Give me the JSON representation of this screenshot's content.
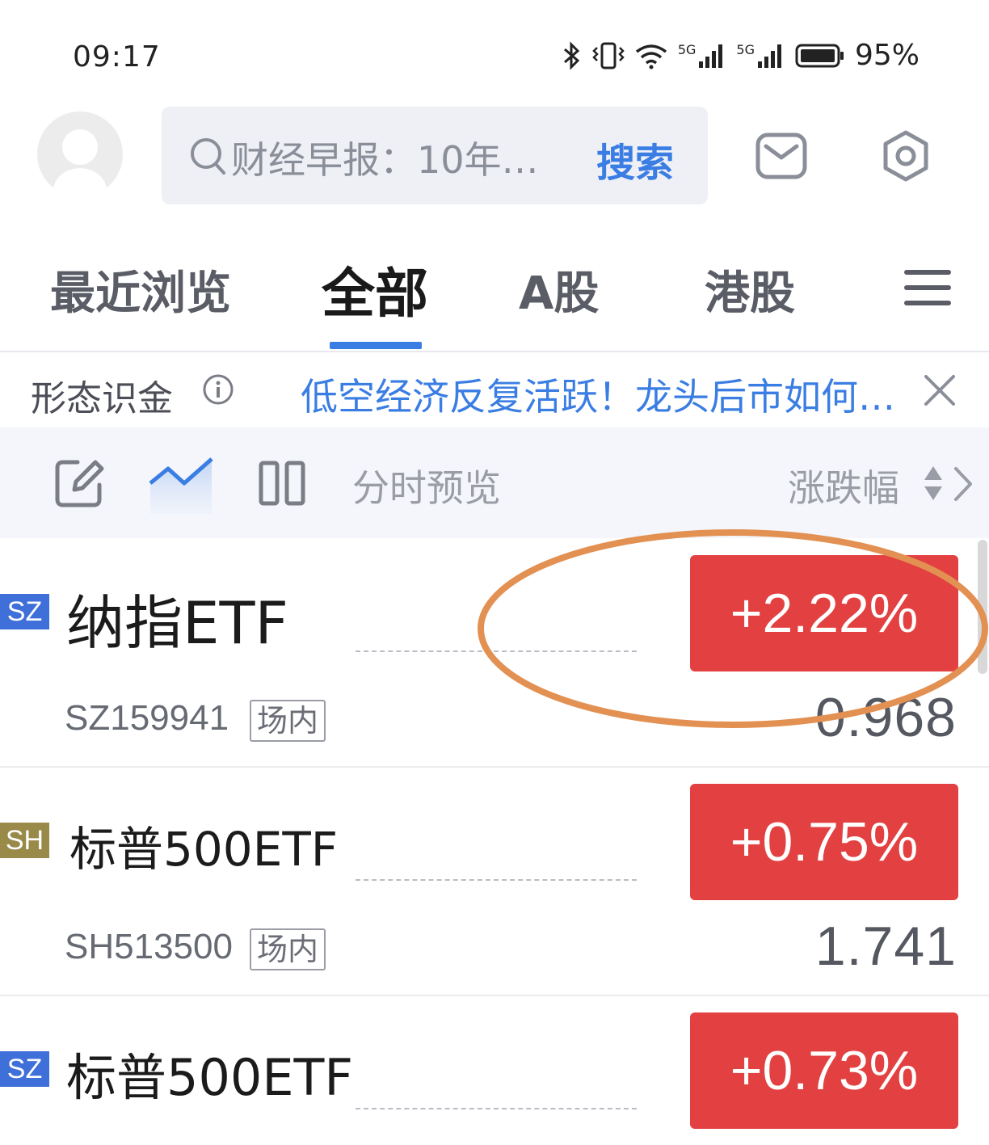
{
  "status_bar": {
    "time": "09:17",
    "network_a": "5G",
    "network_b": "5G",
    "battery": "95%",
    "icons": [
      "bluetooth-icon",
      "vibrate-icon",
      "wifi-icon",
      "signal-icon",
      "signal-icon",
      "battery-icon"
    ]
  },
  "header": {
    "search_placeholder": "财经早报：10年…",
    "search_button": "搜索",
    "icons": [
      "avatar",
      "search-icon",
      "mail-icon",
      "gear-icon"
    ]
  },
  "tabs": [
    {
      "label": "最近浏览",
      "active": false
    },
    {
      "label": "全部",
      "active": true
    },
    {
      "label": "A股",
      "active": false
    },
    {
      "label": "港股",
      "active": false
    }
  ],
  "news": {
    "label": "形态识金",
    "headline": "低空经济反复活跃！龙头后市如何…"
  },
  "toolbar": {
    "preview_label": "分时预览",
    "sort_label": "涨跌幅"
  },
  "colors": {
    "accent": "#3a7de3",
    "rise": "#e34141",
    "annotation": "#e39153",
    "badge_sz": "#3f6fd8",
    "badge_sh": "#9a8a4a"
  },
  "watchlist": [
    {
      "exchange": "SZ",
      "name": "纳指ETF",
      "code": "SZ159941",
      "venue": "场内",
      "change": "+2.22%",
      "price": "0.968"
    },
    {
      "exchange": "SH",
      "name": "标普500ETF",
      "code": "SH513500",
      "venue": "场内",
      "change": "+0.75%",
      "price": "1.741"
    },
    {
      "exchange": "SZ",
      "name": "标普500ETF",
      "change": "+0.73%"
    }
  ]
}
